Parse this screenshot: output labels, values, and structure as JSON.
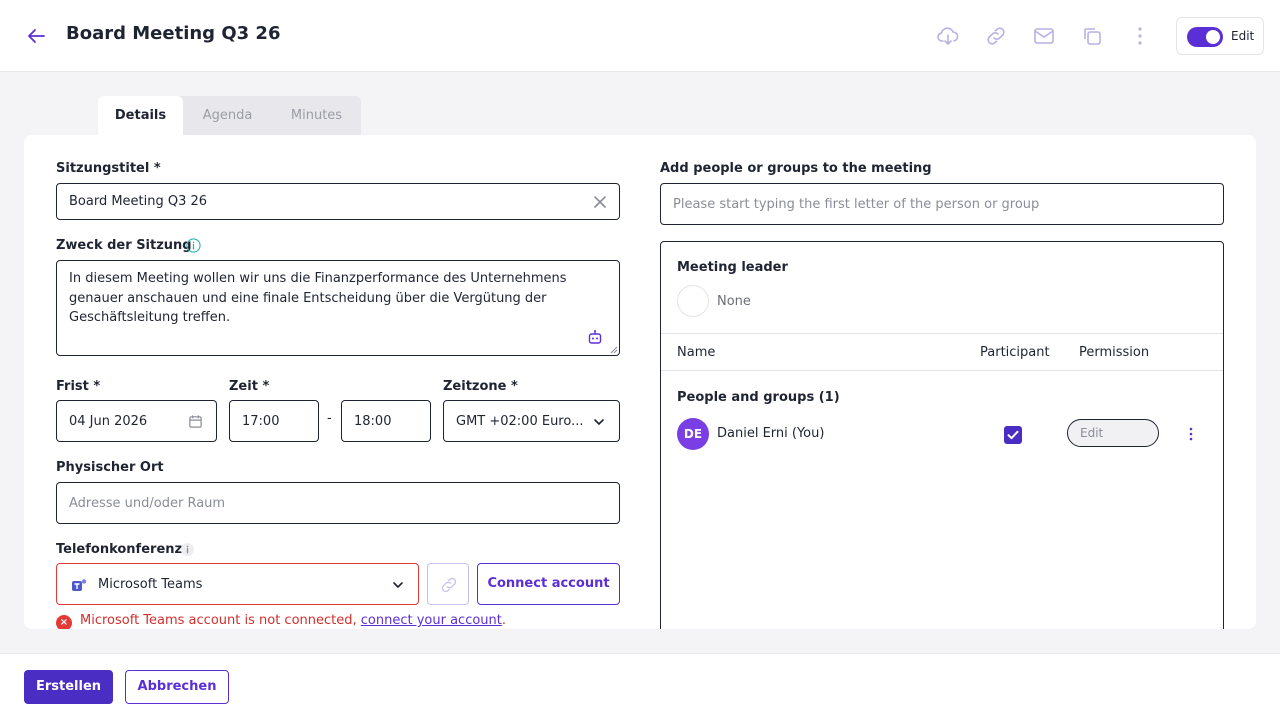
{
  "header": {
    "title": "Board Meeting Q3 26",
    "edit_label": "Edit",
    "icons": [
      "back-arrow-icon",
      "cloud-download-icon",
      "link-icon",
      "mail-icon",
      "copy-icon",
      "more-vertical-icon"
    ]
  },
  "tabs": [
    {
      "label": "Details",
      "active": true
    },
    {
      "label": "Agenda",
      "active": false
    },
    {
      "label": "Minutes",
      "active": false
    }
  ],
  "form": {
    "title_label": "Sitzungstitel *",
    "title_value": "Board Meeting Q3 26",
    "purpose_label": "Zweck der Sitzung",
    "purpose_value": "In diesem Meeting wollen wir uns die Finanzperformance des Unternehmens genauer anschauen und eine finale Entscheidung über die Vergütung der Geschäftsleitung treffen.",
    "deadline_label": "Frist *",
    "deadline_value": "04 Jun 2026",
    "time_label": "Zeit *",
    "time_start": "17:00",
    "time_separator": "-",
    "time_end": "18:00",
    "timezone_label": "Zeitzone *",
    "timezone_value": "GMT +02:00 Euro...",
    "location_label": "Physischer Ort",
    "location_placeholder": "Adresse und/oder Raum",
    "conference_label": "Telefonkonferenz",
    "conference_value": "Microsoft Teams",
    "connect_account_label": "Connect account",
    "error_text": "Microsoft Teams account is not connected, ",
    "error_link": "connect your account",
    "error_suffix": "."
  },
  "people": {
    "label": "Add people or groups to the meeting",
    "search_placeholder": "Please start typing the first letter of the person or group",
    "leader_label": "Meeting leader",
    "leader_value": "None",
    "col_name": "Name",
    "col_participant": "Participant",
    "col_permission": "Permission",
    "group_heading": "People and groups (1)",
    "rows": [
      {
        "initials": "DE",
        "name": "Daniel Erni (You)",
        "participant": true,
        "permission": "Edit"
      }
    ]
  },
  "footer": {
    "create_label": "Erstellen",
    "cancel_label": "Abbrechen"
  },
  "colors": {
    "accent": "#5b2fd6",
    "primary_button": "#4a2dc2",
    "error": "#d32f2f"
  }
}
